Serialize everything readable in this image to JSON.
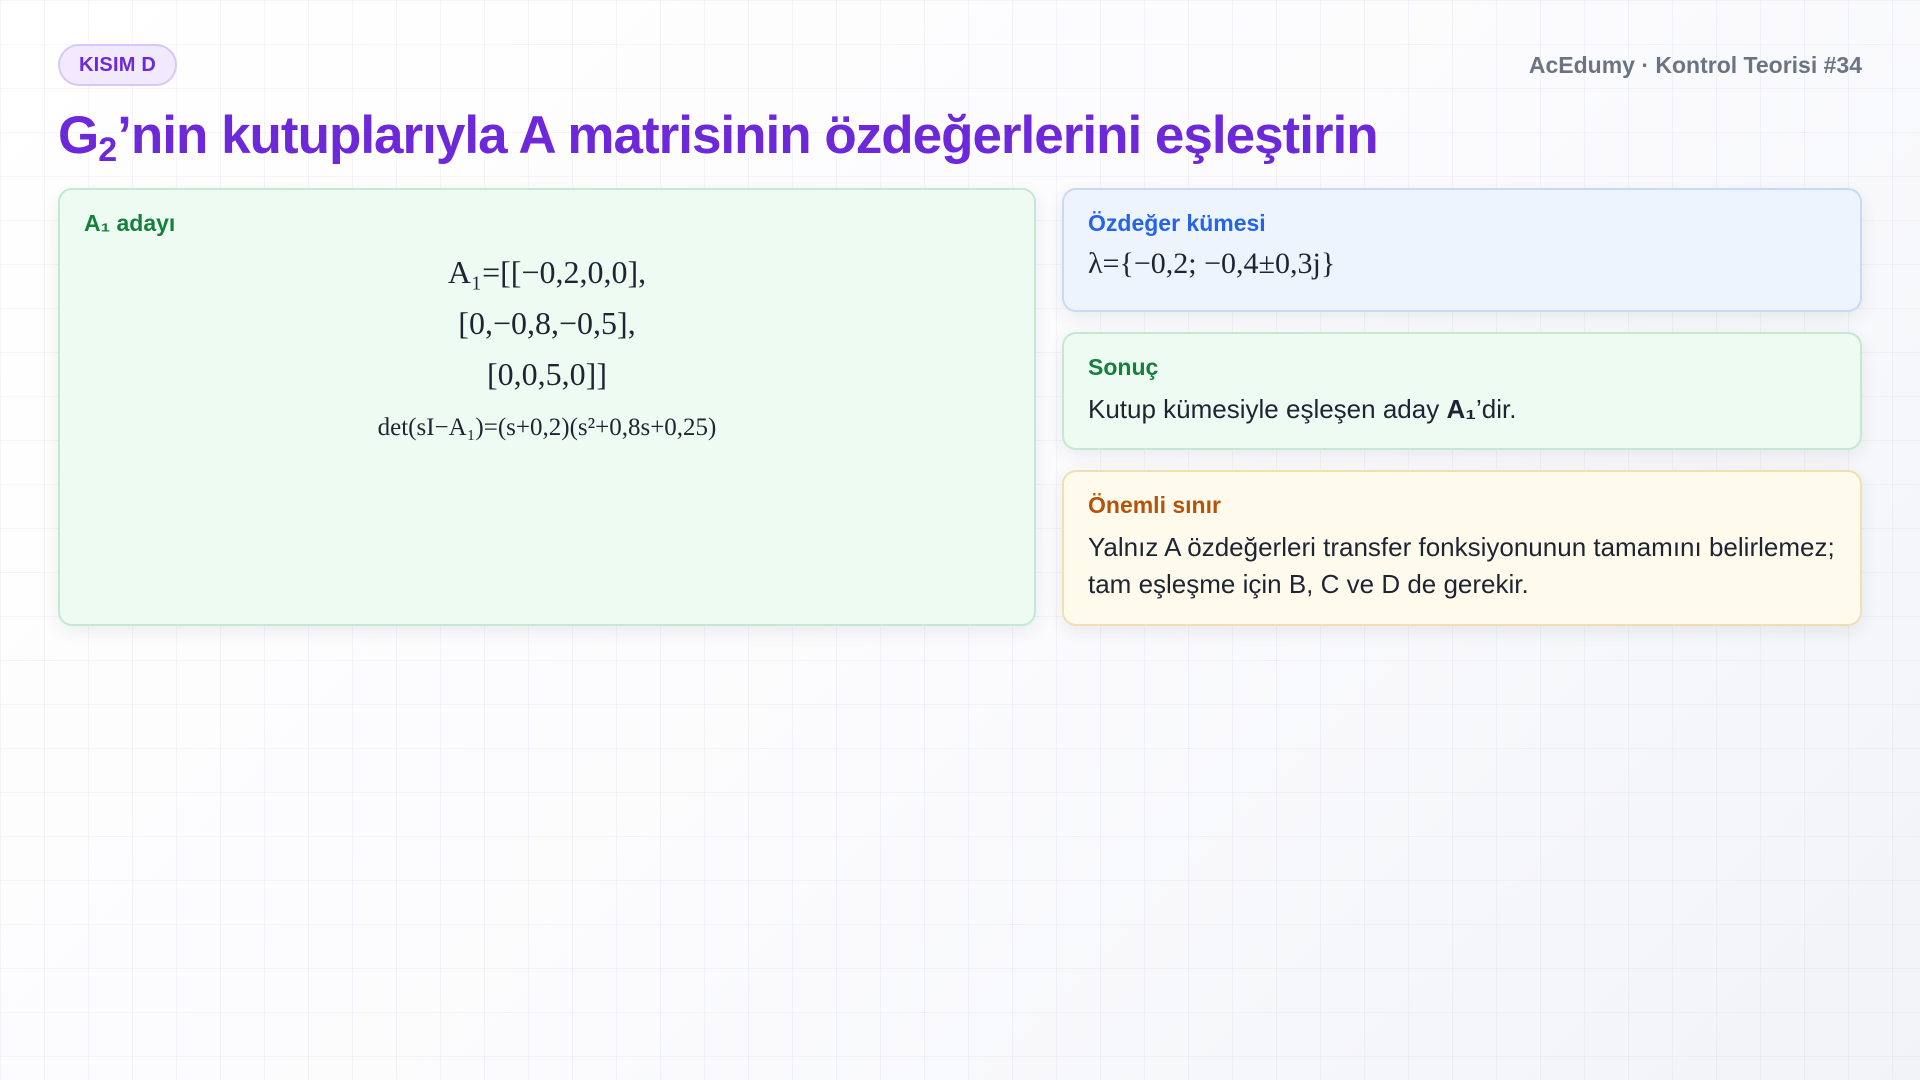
{
  "header": {
    "section_badge": "KISIM D",
    "brand": "AcEdumy · Kontrol Teorisi #34",
    "title_main": "G",
    "title_sub": "2",
    "title_rest": "’nin kutuplarıyla A matrisinin özdeğerlerini eşleştirin"
  },
  "candidate_card": {
    "heading": "A₁ adayı",
    "matrix_rows": [
      "A₁=[[−0,2,0,0],",
      "[0,−0,8,−0,5],",
      "[0,0,5,0]]"
    ],
    "det_line": "det(sI−A₁)=(s+0,2)(s²+0,8s+0,25)"
  },
  "eigen_card": {
    "heading": "Özdeğer kümesi",
    "value": "λ={−0,2; −0,4±0,3j}"
  },
  "result_card": {
    "heading": "Sonuç",
    "text_before": "Kutup kümesiyle eşleşen aday ",
    "text_bold": "A₁",
    "text_after": "’dir."
  },
  "limit_card": {
    "heading": "Önemli sınır",
    "text": "Yalnız A özdeğerleri transfer fonksiyonunun tamamını belirlemez; tam eşleşme için B, C ve D de gerekir."
  },
  "colors": {
    "accent_purple": "#6d28d9",
    "green": "#15803d",
    "blue": "#2563eb",
    "amber": "#b45309"
  }
}
